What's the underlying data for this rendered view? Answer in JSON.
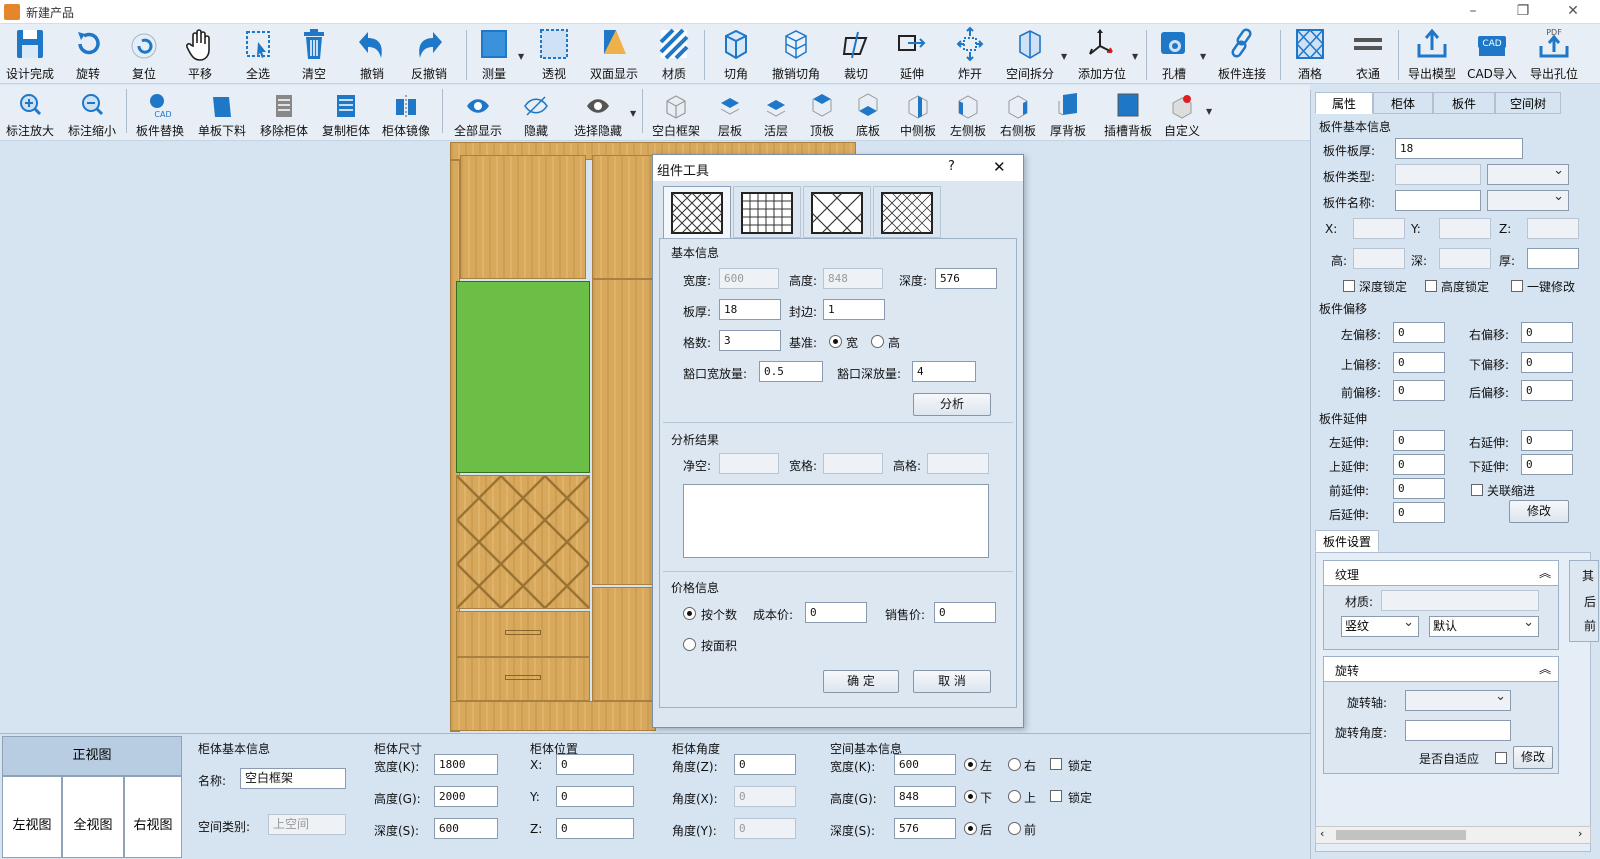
{
  "window": {
    "title": "新建产品",
    "min": "–",
    "max": "❐",
    "close": "✕"
  },
  "toolbar1": [
    {
      "label": "设计完成",
      "icon": "save-icon"
    },
    {
      "label": "旋转",
      "icon": "rotate-icon"
    },
    {
      "label": "复位",
      "icon": "reset-icon"
    },
    {
      "label": "平移",
      "icon": "hand-pan-icon"
    },
    {
      "label": "全选",
      "icon": "select-all-icon"
    },
    {
      "label": "清空",
      "icon": "trash-icon"
    },
    {
      "label": "撤销",
      "icon": "undo-icon"
    },
    {
      "label": "反撤销",
      "icon": "redo-icon"
    },
    {
      "label": "测量",
      "icon": "measure-icon"
    },
    {
      "label": "透视",
      "icon": "perspective-icon"
    },
    {
      "label": "双面显示",
      "icon": "double-side-icon"
    },
    {
      "label": "材质",
      "icon": "material-icon"
    },
    {
      "label": "切角",
      "icon": "chamfer-icon"
    },
    {
      "label": "撤销切角",
      "icon": "undo-chamfer-icon"
    },
    {
      "label": "裁切",
      "icon": "cut-icon"
    },
    {
      "label": "延伸",
      "icon": "extend-icon"
    },
    {
      "label": "炸开",
      "icon": "explode-icon"
    },
    {
      "label": "空间拆分",
      "icon": "space-split-icon"
    },
    {
      "label": "添加方位",
      "icon": "axis-icon"
    },
    {
      "label": "孔槽",
      "icon": "hole-slot-icon"
    },
    {
      "label": "板件连接",
      "icon": "link-icon"
    },
    {
      "label": "酒格",
      "icon": "wine-grid-icon"
    },
    {
      "label": "衣通",
      "icon": "rail-icon"
    },
    {
      "label": "导出模型",
      "icon": "export-model-icon"
    },
    {
      "label": "CAD导入",
      "icon": "cad-import-icon"
    },
    {
      "label": "导出孔位",
      "icon": "export-pdf-icon"
    }
  ],
  "toolbar2": [
    {
      "label": "标注放大",
      "icon": "zoom-in-icon"
    },
    {
      "label": "标注缩小",
      "icon": "zoom-out-icon"
    },
    {
      "label": "板件替换",
      "icon": "board-replace-icon"
    },
    {
      "label": "单板下料",
      "icon": "single-board-icon"
    },
    {
      "label": "移除柜体",
      "icon": "remove-cabinet-icon"
    },
    {
      "label": "复制柜体",
      "icon": "copy-cabinet-icon"
    },
    {
      "label": "柜体镜像",
      "icon": "mirror-cabinet-icon"
    },
    {
      "label": "全部显示",
      "icon": "eye-icon"
    },
    {
      "label": "隐藏",
      "icon": "hide-icon"
    },
    {
      "label": "选择隐藏",
      "icon": "select-hide-icon"
    },
    {
      "label": "空白框架",
      "icon": "blank-frame-icon"
    },
    {
      "label": "层板",
      "icon": "shelf-icon"
    },
    {
      "label": "活层",
      "icon": "movable-shelf-icon"
    },
    {
      "label": "顶板",
      "icon": "top-board-icon"
    },
    {
      "label": "底板",
      "icon": "bottom-board-icon"
    },
    {
      "label": "中侧板",
      "icon": "mid-side-icon"
    },
    {
      "label": "左侧板",
      "icon": "left-side-icon"
    },
    {
      "label": "右侧板",
      "icon": "right-side-icon"
    },
    {
      "label": "厚背板",
      "icon": "thick-back-icon"
    },
    {
      "label": "插槽背板",
      "icon": "slot-back-icon"
    },
    {
      "label": "自定义",
      "icon": "custom-icon"
    }
  ],
  "dialog": {
    "title": "组件工具",
    "help": "?",
    "close": "✕",
    "basic_title": "基本信息",
    "width_label": "宽度:",
    "width": "600",
    "height_label": "高度:",
    "height": "848",
    "depth_label": "深度:",
    "depth": "576",
    "thick_label": "板厚:",
    "thick": "18",
    "edge_label": "封边:",
    "edge": "1",
    "grid_label": "格数:",
    "grid": "3",
    "base_label": "基准:",
    "base_w": "宽",
    "base_h": "高",
    "gapw_label": "豁口宽放量:",
    "gapw": "0.5",
    "gapd_label": "豁口深放量:",
    "gapd": "4",
    "analyze": "分析",
    "result_title": "分析结果",
    "net_label": "净空:",
    "wgrid_label": "宽格:",
    "hgrid_label": "高格:",
    "price_title": "价格信息",
    "by_count": "按个数",
    "cost_label": "成本价:",
    "cost": "0",
    "sale_label": "销售价:",
    "sale": "0",
    "by_area": "按面积",
    "ok": "确 定",
    "cancel": "取 消"
  },
  "right_panel": {
    "tabs": [
      "属性",
      "柜体",
      "板件",
      "空间树"
    ],
    "basic_title": "板件基本信息",
    "thick_label": "板件板厚:",
    "thick": "18",
    "type_label": "板件类型:",
    "name_label": "板件名称:",
    "x_label": "X:",
    "y_label": "Y:",
    "z_label": "Z:",
    "h_label": "高:",
    "d_label": "深:",
    "t_label": "厚:",
    "lock_depth": "深度锁定",
    "lock_height": "高度锁定",
    "one_key": "一键修改",
    "offset_title": "板件偏移",
    "left_off": "左偏移:",
    "right_off": "右偏移:",
    "up_off": "上偏移:",
    "down_off": "下偏移:",
    "front_off": "前偏移:",
    "back_off": "后偏移:",
    "offset_vals": [
      "0",
      "0",
      "0",
      "0",
      "0",
      "0"
    ],
    "ext_title": "板件延伸",
    "left_ext": "左延伸:",
    "right_ext": "右延伸:",
    "up_ext": "上延伸:",
    "down_ext": "下延伸:",
    "front_ext": "前延伸:",
    "back_ext": "后延伸:",
    "ext_vals": [
      "0",
      "0",
      "0",
      "0",
      "0",
      "0"
    ],
    "link_shrink": "关联缩进",
    "modify": "修改",
    "settings_tab": "板件设置",
    "texture_title": "纹理",
    "material_label": "材质:",
    "grain": "竖纹",
    "default": "默认",
    "rotate_title": "旋转",
    "axis_label": "旋转轴:",
    "angle_label": "旋转角度:",
    "adaptive_label": "是否自适应",
    "modify2": "修改",
    "clip_chars": [
      "其",
      "后",
      "前"
    ]
  },
  "bottom": {
    "views": {
      "front": "正视图",
      "left": "左视图",
      "all": "全视图",
      "right": "右视图"
    },
    "cab_title": "柜体基本信息",
    "name_label": "名称:",
    "name": "空白框架",
    "space_type_label": "空间类别:",
    "space_type": "上空间",
    "size_title": "柜体尺寸",
    "width_label": "宽度(K):",
    "width": "1800",
    "height_label": "高度(G):",
    "height": "2000",
    "depth_label": "深度(S):",
    "depth": "600",
    "pos_title": "柜体位置",
    "x_label": "X:",
    "x": "0",
    "y_label": "Y:",
    "y": "0",
    "z_label": "Z:",
    "z": "0",
    "angle_title": "柜体角度",
    "az_label": "角度(Z):",
    "az": "0",
    "ax_label": "角度(X):",
    "ax": "0",
    "ay_label": "角度(Y):",
    "ay": "0",
    "space_title": "空间基本信息",
    "sw_label": "宽度(K):",
    "sw": "600",
    "sh_label": "高度(G):",
    "sh": "848",
    "sd_label": "深度(S):",
    "sd": "576",
    "left": "左",
    "right": "右",
    "down": "下",
    "up": "上",
    "back": "后",
    "front": "前",
    "lock": "锁定"
  }
}
